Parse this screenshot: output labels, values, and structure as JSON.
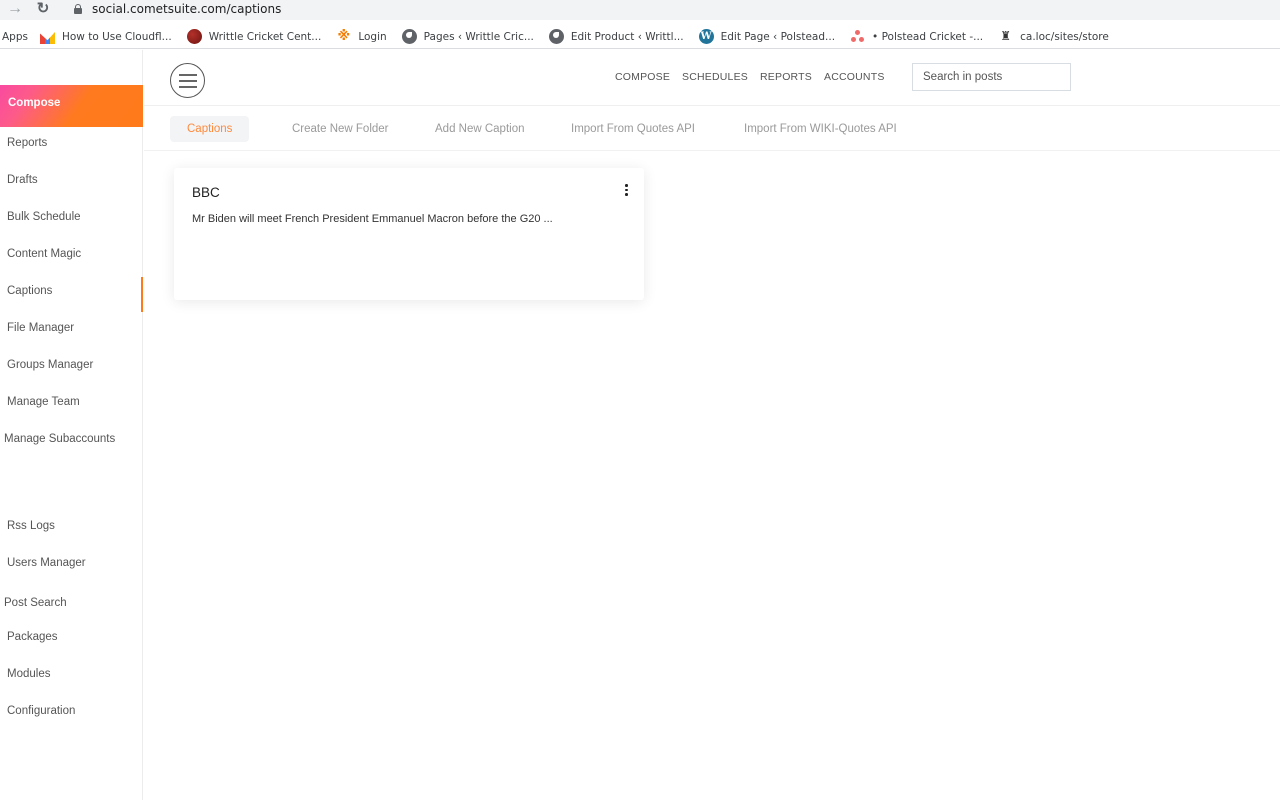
{
  "browser": {
    "url": "social.cometsuite.com/captions",
    "bookmarks": [
      {
        "label": "Apps",
        "icon": "apps"
      },
      {
        "label": "How to Use Cloudfl...",
        "icon": "cloudflare-icon"
      },
      {
        "label": "Writtle Cricket Cent...",
        "icon": "cricket-ball-icon"
      },
      {
        "label": "Login",
        "icon": "login-icon"
      },
      {
        "label": "Pages ‹ Writtle Cric...",
        "icon": "globe-icon"
      },
      {
        "label": "Edit Product ‹ Writtl...",
        "icon": "globe-icon"
      },
      {
        "label": "Edit Page ‹ Polstead...",
        "icon": "wordpress-icon"
      },
      {
        "label": "• Polstead Cricket -...",
        "icon": "asana-icon"
      },
      {
        "label": "ca.loc/sites/store",
        "icon": "store-icon"
      }
    ]
  },
  "sidebar": {
    "compose_label": "Compose",
    "items": [
      {
        "label": "Reports"
      },
      {
        "label": "Drafts"
      },
      {
        "label": "Bulk Schedule"
      },
      {
        "label": "Content Magic"
      },
      {
        "label": "Captions",
        "active": true
      },
      {
        "label": "File Manager"
      },
      {
        "label": "Groups Manager"
      },
      {
        "label": "Manage Team"
      },
      {
        "label": "Manage Subaccounts"
      },
      {
        "label": "Rss Logs"
      },
      {
        "label": "Users Manager"
      },
      {
        "label": "Post Search"
      },
      {
        "label": "Packages"
      },
      {
        "label": "Modules"
      },
      {
        "label": "Configuration"
      }
    ]
  },
  "header": {
    "nav": [
      "COMPOSE",
      "SCHEDULES",
      "REPORTS",
      "ACCOUNTS"
    ],
    "search_placeholder": "Search in posts"
  },
  "subnav": {
    "tabs": [
      "Captions",
      "Create New Folder",
      "Add New Caption",
      "Import From Quotes API",
      "Import From WIKI-Quotes API"
    ],
    "active_tab": "Captions"
  },
  "captions": [
    {
      "title": "BBC",
      "text": "Mr Biden will meet French President Emmanuel Macron before the G20 ..."
    }
  ],
  "colors": {
    "accent": "#ff7a1a",
    "accent_pink": "#f94aa0",
    "active_tab_text": "#ff8a3d"
  }
}
